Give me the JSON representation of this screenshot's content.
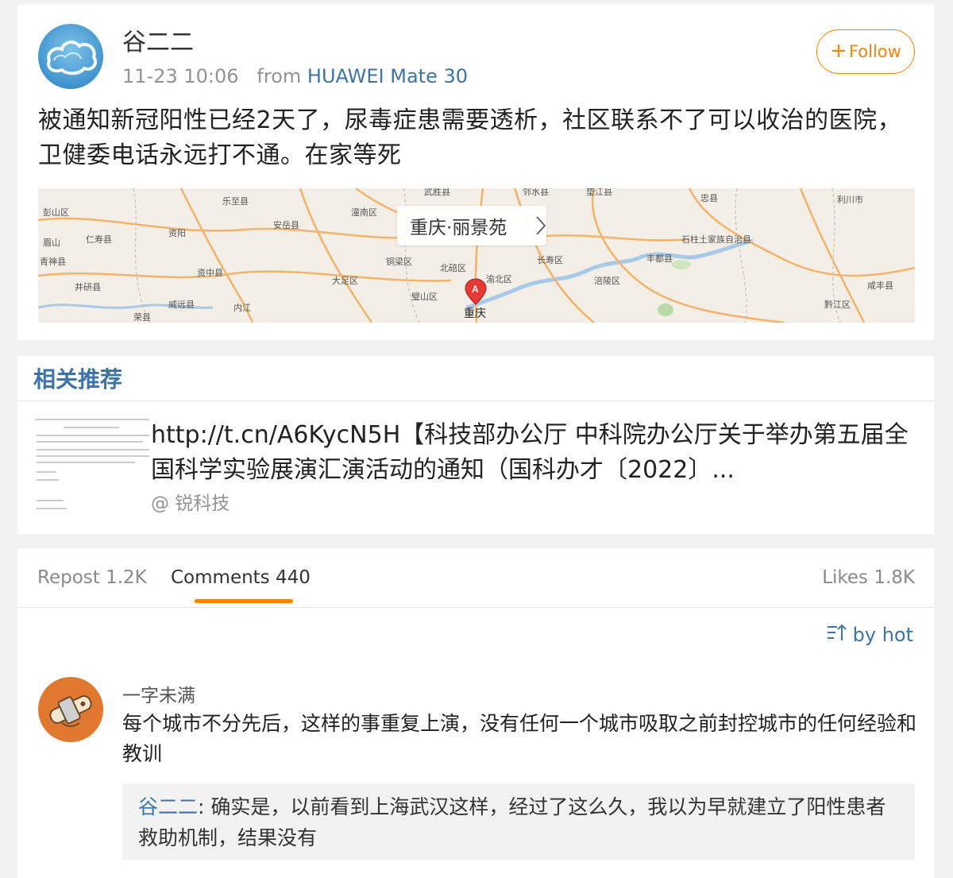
{
  "post": {
    "username": "谷二二",
    "timestamp": "11-23 10:06",
    "from_label": "from",
    "device": "HUAWEI Mate 30",
    "follow_label": "Follow",
    "text": "被通知新冠阳性已经2天了，尿毒症患需要透析，社区联系不了可以收治的医院，卫健委电话永远打不通。在家等死",
    "location": {
      "label": "重庆·丽景苑",
      "pin": "A",
      "map_labels": [
        "彭山区",
        "乐至县",
        "武胜县",
        "邻水县",
        "垫江县",
        "忠县",
        "利川市",
        "潼南区",
        "眉山",
        "仁寿县",
        "资阳",
        "安岳县",
        "石柱土家族自治县",
        "青神县",
        "铜梁区",
        "北碚区",
        "长寿区",
        "丰都县",
        "资中县",
        "大足区",
        "渝北区",
        "井研县",
        "涪陵区",
        "威远县",
        "璧山区",
        "黔江区",
        "咸丰县",
        "内江",
        "荣县",
        "重庆"
      ]
    }
  },
  "recommended": {
    "header": "相关推荐",
    "title": "http://t.cn/A6KycN5H【科技部办公厅 中科院办公厅关于举办第五届全国科学实验展演汇演活动的通知（国科办才〔2022〕...",
    "source": "@ 锐科技"
  },
  "comments_section": {
    "tabs": {
      "repost": "Repost 1.2K",
      "comments": "Comments 440",
      "likes": "Likes 1.8K"
    },
    "sort_label": "by hot",
    "comment": {
      "name": "一字未满",
      "text": "每个城市不分先后，这样的事重复上演，没有任何一个城市吸取之前封控城市的任何经验和教训",
      "reply": {
        "name": "谷二二",
        "separator": ": ",
        "text": "确实是，以前看到上海武汉这样，经过了这么久，我以为早就建立了阳性患者救助机制，结果没有"
      }
    }
  },
  "colors": {
    "accent_orange": "#ff8200",
    "link_blue": "#3d73a8",
    "background": "#f2f2f2"
  }
}
